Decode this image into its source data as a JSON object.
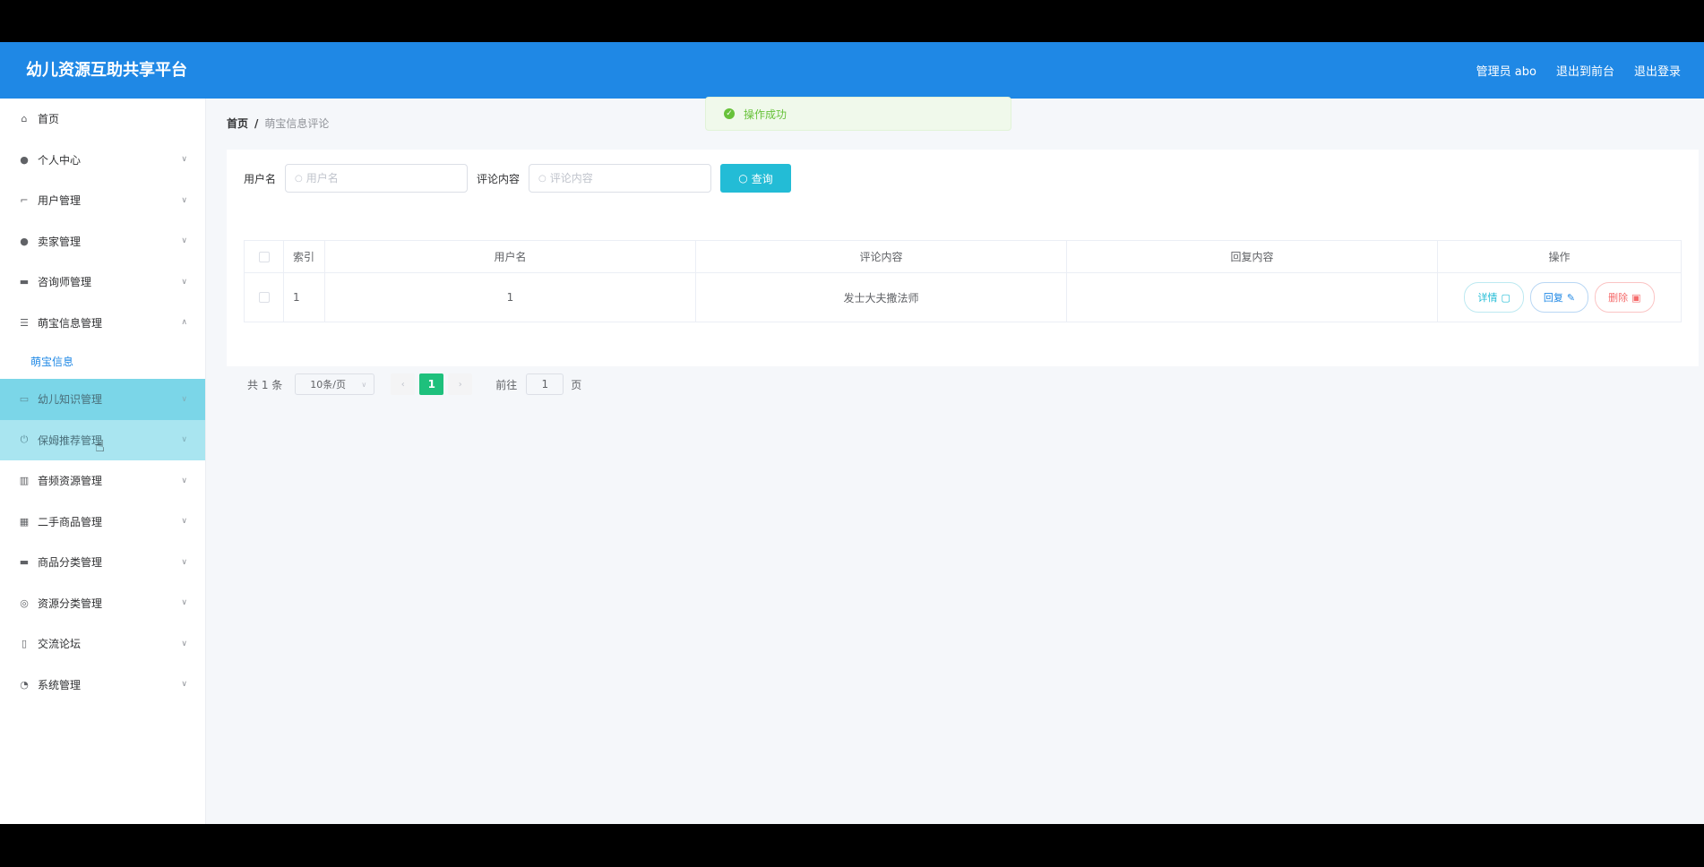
{
  "app": {
    "title": "幼儿资源互助共享平台"
  },
  "header": {
    "user": "管理员 abo",
    "to_front": "退出到前台",
    "logout": "退出登录"
  },
  "toast": {
    "message": "操作成功"
  },
  "sidebar": {
    "items": [
      {
        "label": "首页",
        "icon": "home-icon"
      },
      {
        "label": "个人中心",
        "icon": "user-icon"
      },
      {
        "label": "用户管理",
        "icon": "crop-icon"
      },
      {
        "label": "卖家管理",
        "icon": "user-icon"
      },
      {
        "label": "咨询师管理",
        "icon": "briefcase-icon"
      },
      {
        "label": "萌宝信息管理",
        "icon": "sliders-icon"
      },
      {
        "label": "幼儿知识管理",
        "icon": "card-icon"
      },
      {
        "label": "保姆推荐管理",
        "icon": "power-icon"
      },
      {
        "label": "音频资源管理",
        "icon": "library-icon"
      },
      {
        "label": "二手商品管理",
        "icon": "grid-icon"
      },
      {
        "label": "商品分类管理",
        "icon": "printer-icon"
      },
      {
        "label": "资源分类管理",
        "icon": "aperture-icon"
      },
      {
        "label": "交流论坛",
        "icon": "mic-icon"
      },
      {
        "label": "系统管理",
        "icon": "gauge-icon"
      }
    ],
    "sub_item": "萌宝信息"
  },
  "breadcrumb": {
    "home": "首页",
    "sep": "/",
    "current": "萌宝信息评论"
  },
  "filter": {
    "username_label": "用户名",
    "username_placeholder": "用户名",
    "comment_label": "评论内容",
    "comment_placeholder": "评论内容",
    "query_label": "查询"
  },
  "table": {
    "headers": {
      "index": "索引",
      "username": "用户名",
      "comment": "评论内容",
      "reply": "回复内容",
      "actions": "操作"
    },
    "rows": [
      {
        "index": "1",
        "username": "1",
        "comment": "发士大夫撒法师",
        "reply": ""
      }
    ],
    "actions": {
      "detail": "详情",
      "reply": "回复",
      "delete": "删除"
    }
  },
  "pager": {
    "total": "共 1 条",
    "page_size": "10条/页",
    "current": "1",
    "goto_label": "前往",
    "goto_value": "1",
    "page_suffix": "页"
  },
  "colors": {
    "header": "#1f88e5",
    "accent": "#23bcd6",
    "page_active": "#1ec07c",
    "danger": "#f56c6c",
    "success": "#67c23a"
  }
}
